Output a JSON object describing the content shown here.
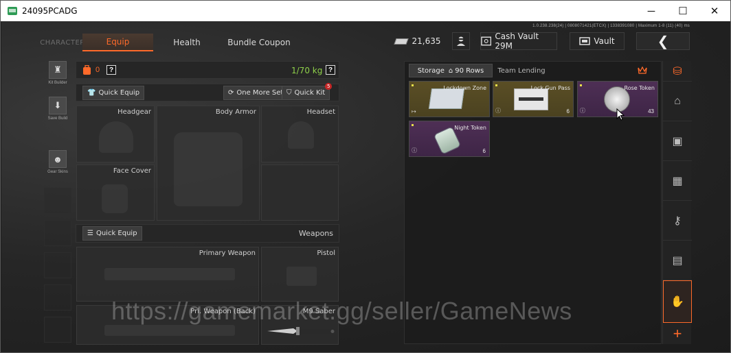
{
  "window": {
    "title": "24095PCADG",
    "min_glyph": "─",
    "max_glyph": "☐",
    "close_glyph": "✕"
  },
  "build_info": "1.0.238.238(24) | 0808071421(ETCX) | 1338391080 | Maximum 1-8 (11) (40) ms",
  "nav": {
    "character": "CHARACTER",
    "equip": "Equip",
    "health": "Health",
    "bundle": "Bundle Coupon"
  },
  "hud": {
    "money": "21,635",
    "cash_vault": "Cash Vault 29M",
    "vault": "Vault",
    "back_glyph": "❮"
  },
  "sidebar": [
    {
      "label": "Kit Builder",
      "glyph": "♜"
    },
    {
      "label": "Save Build",
      "glyph": "⬇"
    },
    {
      "label": "Gear Skins",
      "glyph": "☻"
    }
  ],
  "loadout": {
    "backpack_count": "0",
    "help_glyph": "?",
    "weight": "1/70 kg",
    "quick_equip_1": "Quick Equip",
    "one_more_set": "One More Set",
    "quick_kit": "Quick Kit",
    "quick_kit_badge": "5",
    "slots": {
      "headgear": "Headgear",
      "body_armor": "Body Armor",
      "headset": "Headset",
      "face_cover": "Face Cover"
    },
    "quick_equip_2": "Quick Equip",
    "weapons_header": "Weapons",
    "primary_weapon": "Primary Weapon",
    "pistol": "Pistol",
    "pri_weapon_back": "Pri. Weapon (Back)",
    "melee_name": "M9 Saber"
  },
  "storage": {
    "tab_storage": "Storage",
    "rows": "90 Rows",
    "tab_team": "Team Lending",
    "items": [
      {
        "name": "Lockdown Zone",
        "qty": "",
        "corner": "↦",
        "rarity_color": "#5a4e25"
      },
      {
        "name": "Lock Gun Pass",
        "qty": "6",
        "corner": "ⓘ",
        "rarity_color": "#5a4e25"
      },
      {
        "name": "Rose Token",
        "qty": "43",
        "corner": "ⓘ",
        "rarity_color": "#4e2f55"
      },
      {
        "name": "Night Token",
        "qty": "6",
        "corner": "ⓘ",
        "rarity_color": "#4e2f55"
      }
    ]
  },
  "rail": {
    "plus_glyph": "+"
  },
  "watermark": "https://gamemarket.gg/seller/GameNews",
  "colors": {
    "accent": "#ff6a2a",
    "weight_green": "#8fd14a"
  }
}
